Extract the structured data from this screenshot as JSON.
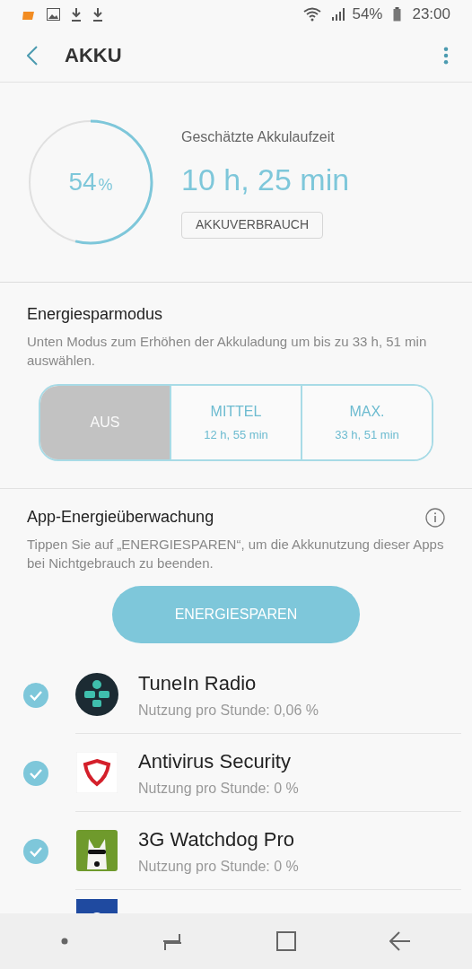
{
  "status_bar": {
    "battery": "54%",
    "time": "23:00"
  },
  "header": {
    "title": "AKKU"
  },
  "battery": {
    "percent": "54",
    "unit": "%",
    "estimate_label": "Geschätzte Akkulaufzeit",
    "estimate": "10 h, 25 min",
    "usage_button": "AKKUVERBRAUCH"
  },
  "power_saving": {
    "title": "Energiesparmodus",
    "description": "Unten Modus zum Erhöhen der Akkuladung um bis zu 33 h, 51 min auswählen.",
    "modes": [
      {
        "label": "AUS",
        "selected": true
      },
      {
        "label": "MITTEL",
        "time": "12 h, 55 min",
        "selected": false
      },
      {
        "label": "MAX.",
        "time": "33 h, 51 min",
        "selected": false
      }
    ]
  },
  "app_monitor": {
    "title": "App-Energieüberwachung",
    "description": "Tippen Sie auf „ENERGIESPAREN“, um die Akkunutzung dieser Apps bei Nichtgebrauch zu beenden.",
    "button": "ENERGIESPAREN",
    "apps": [
      {
        "name": "TuneIn Radio",
        "usage": "Nutzung pro Stunde: 0,06 %",
        "checked": true,
        "kind": "tunein"
      },
      {
        "name": "Antivirus Security",
        "usage": "Nutzung pro Stunde: 0 %",
        "checked": true,
        "kind": "shield"
      },
      {
        "name": "3G Watchdog Pro",
        "usage": "Nutzung pro Stunde: 0 %",
        "checked": true,
        "kind": "dog"
      },
      {
        "kind": "control"
      }
    ]
  }
}
